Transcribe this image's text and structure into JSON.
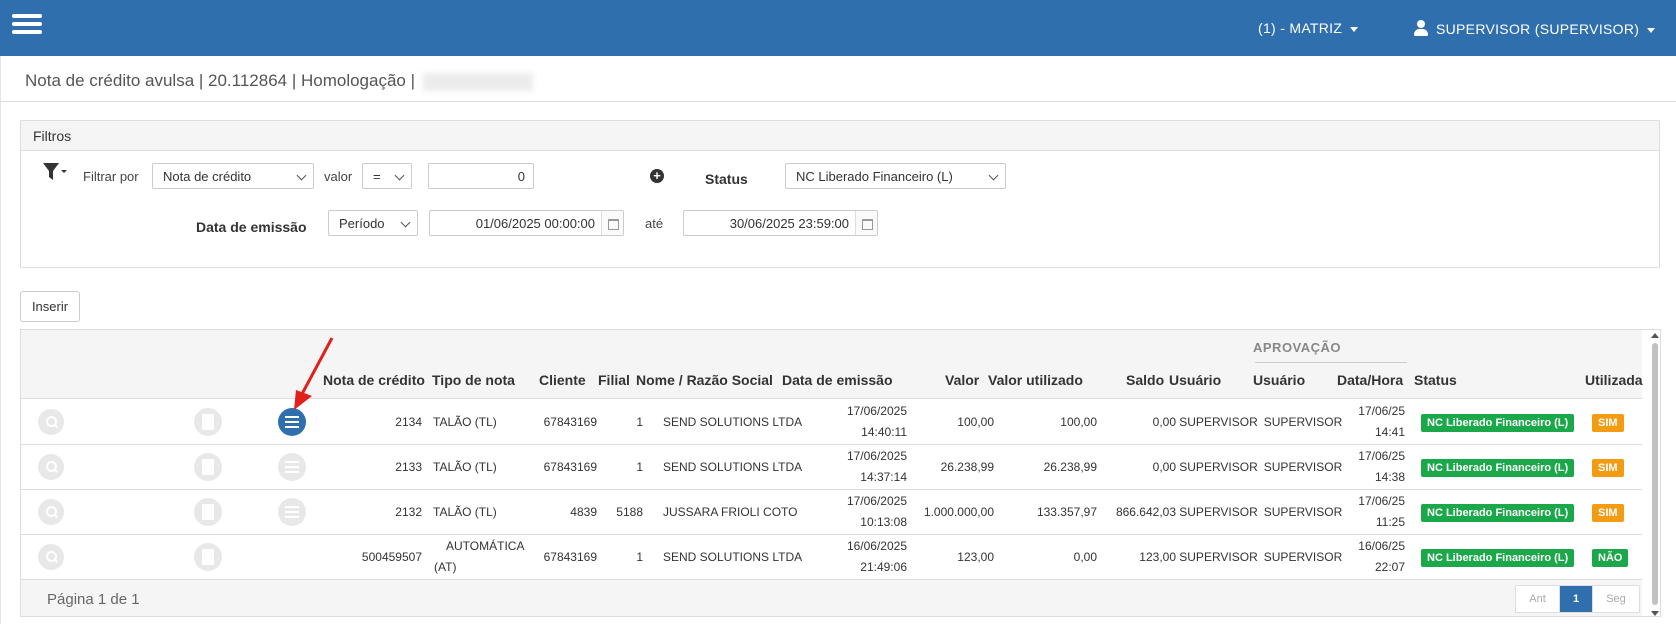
{
  "navbar": {
    "matriz_label": "(1) - MATRIZ",
    "user_label": "SUPERVISOR (SUPERVISOR)"
  },
  "page": {
    "title": "Nota de crédito avulsa | 20.112864 | Homologação |"
  },
  "filters": {
    "panel_title": "Filtros",
    "filter_by_label": "Filtrar por",
    "filter_by_value": "Nota de crédito",
    "valor_label": "valor",
    "operator_value": "=",
    "value_input": "0",
    "status_label": "Status",
    "status_value": "NC Liberado Financeiro (L)",
    "emission_label": "Data de emissão",
    "period_value": "Período",
    "date_from": "01/06/2025 00:00:00",
    "ate_label": "até",
    "date_to": "30/06/2025 23:59:00"
  },
  "insert_button": "Inserir",
  "table": {
    "group_header": "APROVAÇÃO",
    "columns": {
      "nota": "Nota de crédito",
      "tipo": "Tipo de nota",
      "cliente": "Cliente",
      "filial": "Filial",
      "nome": "Nome / Razão Social",
      "data_emissao": "Data de emissão",
      "valor": "Valor",
      "valor_utilizado": "Valor utilizado",
      "saldo": "Saldo",
      "usuario": "Usuário",
      "aprov_usuario": "Usuário",
      "aprov_data": "Data/Hora",
      "status": "Status",
      "utilizada": "Utilizada"
    },
    "rows": [
      {
        "nota": "2134",
        "tipo1": "TALÃO (TL)",
        "tipo2": "",
        "cliente": "67843169",
        "filial": "1",
        "nome": "SEND SOLUTIONS LTDA",
        "data1": "17/06/2025",
        "data2": "14:40:11",
        "valor": "100,00",
        "valor_utilizado": "100,00",
        "saldo": "0,00",
        "usuario": "SUPERVISOR",
        "aprov_usuario": "SUPERVISOR",
        "aprov_data1": "17/06/25",
        "aprov_data2": "14:41",
        "status": "NC Liberado Financeiro (L)",
        "utilizada": "SIM"
      },
      {
        "nota": "2133",
        "tipo1": "TALÃO (TL)",
        "tipo2": "",
        "cliente": "67843169",
        "filial": "1",
        "nome": "SEND SOLUTIONS LTDA",
        "data1": "17/06/2025",
        "data2": "14:37:14",
        "valor": "26.238,99",
        "valor_utilizado": "26.238,99",
        "saldo": "0,00",
        "usuario": "SUPERVISOR",
        "aprov_usuario": "SUPERVISOR",
        "aprov_data1": "17/06/25",
        "aprov_data2": "14:38",
        "status": "NC Liberado Financeiro (L)",
        "utilizada": "SIM"
      },
      {
        "nota": "2132",
        "tipo1": "TALÃO (TL)",
        "tipo2": "",
        "cliente": "4839",
        "filial": "5188",
        "nome": "JUSSARA FRIOLI COTO",
        "data1": "17/06/2025",
        "data2": "10:13:08",
        "valor": "1.000.000,00",
        "valor_utilizado": "133.357,97",
        "saldo": "866.642,03",
        "usuario": "SUPERVISOR",
        "aprov_usuario": "SUPERVISOR",
        "aprov_data1": "17/06/25",
        "aprov_data2": "11:25",
        "status": "NC Liberado Financeiro (L)",
        "utilizada": "SIM"
      },
      {
        "nota": "500459507",
        "tipo1": "AUTOMÁTICA",
        "tipo2": "(AT)",
        "cliente": "67843169",
        "filial": "1",
        "nome": "SEND SOLUTIONS LTDA",
        "data1": "16/06/2025",
        "data2": "21:49:06",
        "valor": "123,00",
        "valor_utilizado": "0,00",
        "saldo": "123,00",
        "usuario": "SUPERVISOR",
        "aprov_usuario": "SUPERVISOR",
        "aprov_data1": "16/06/25",
        "aprov_data2": "22:07",
        "status": "NC Liberado Financeiro (L)",
        "utilizada": "NÃO"
      }
    ]
  },
  "pagination": {
    "info": "Página 1 de 1",
    "prev": "Ant",
    "current": "1",
    "next": "Seg"
  },
  "colors": {
    "navbar": "#2f6fae",
    "badge_green": "#1ba84a",
    "badge_orange": "#f39c12",
    "annotation": "#e0201b"
  }
}
